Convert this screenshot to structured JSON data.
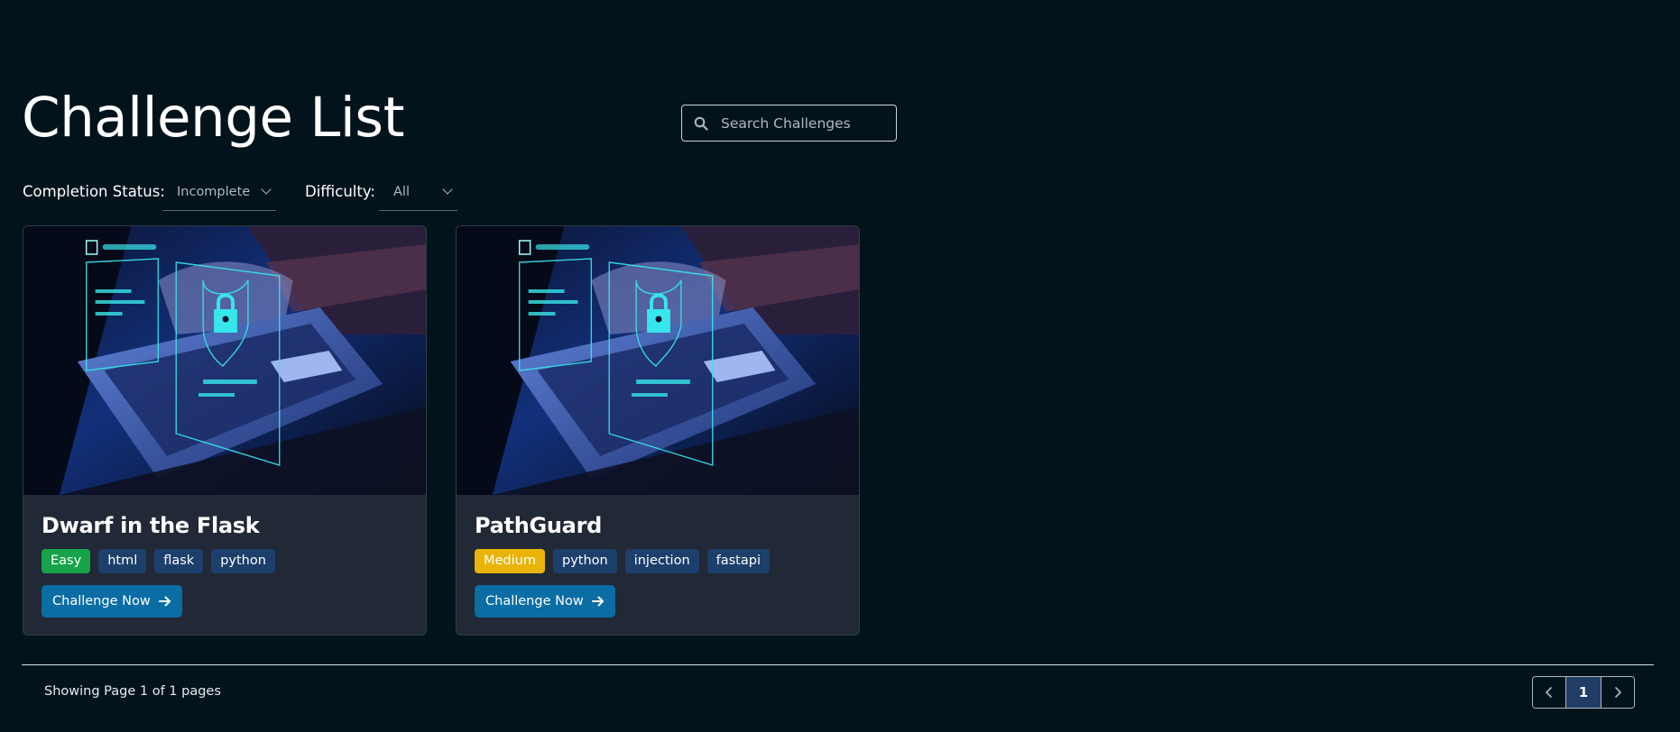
{
  "header": {
    "title": "Challenge List"
  },
  "search": {
    "placeholder": "Search Challenges",
    "value": "",
    "icon": "search-icon"
  },
  "filters": {
    "completion_label": "Completion Status:",
    "completion_value": "Incomplete",
    "difficulty_label": "Difficulty:",
    "difficulty_value": "All"
  },
  "challenges": [
    {
      "title": "Dwarf in the Flask",
      "difficulty": "Easy",
      "tags": [
        "html",
        "flask",
        "python"
      ],
      "cta": "Challenge Now",
      "image": "cybersecurity-laptop-lock-image"
    },
    {
      "title": "PathGuard",
      "difficulty": "Medium",
      "tags": [
        "python",
        "injection",
        "fastapi"
      ],
      "cta": "Challenge Now",
      "image": "cybersecurity-laptop-lock-image"
    }
  ],
  "pagination": {
    "status": "Showing Page 1 of 1 pages",
    "current_page": "1",
    "prev_icon": "chevron-left-icon",
    "next_icon": "chevron-right-icon"
  },
  "colors": {
    "background": "#02131c",
    "card": "#212936",
    "tag": "#1c3f6b",
    "easy": "#16a34a",
    "medium": "#eab308",
    "button": "#0a6da4",
    "current_page": "#1f3d66"
  }
}
